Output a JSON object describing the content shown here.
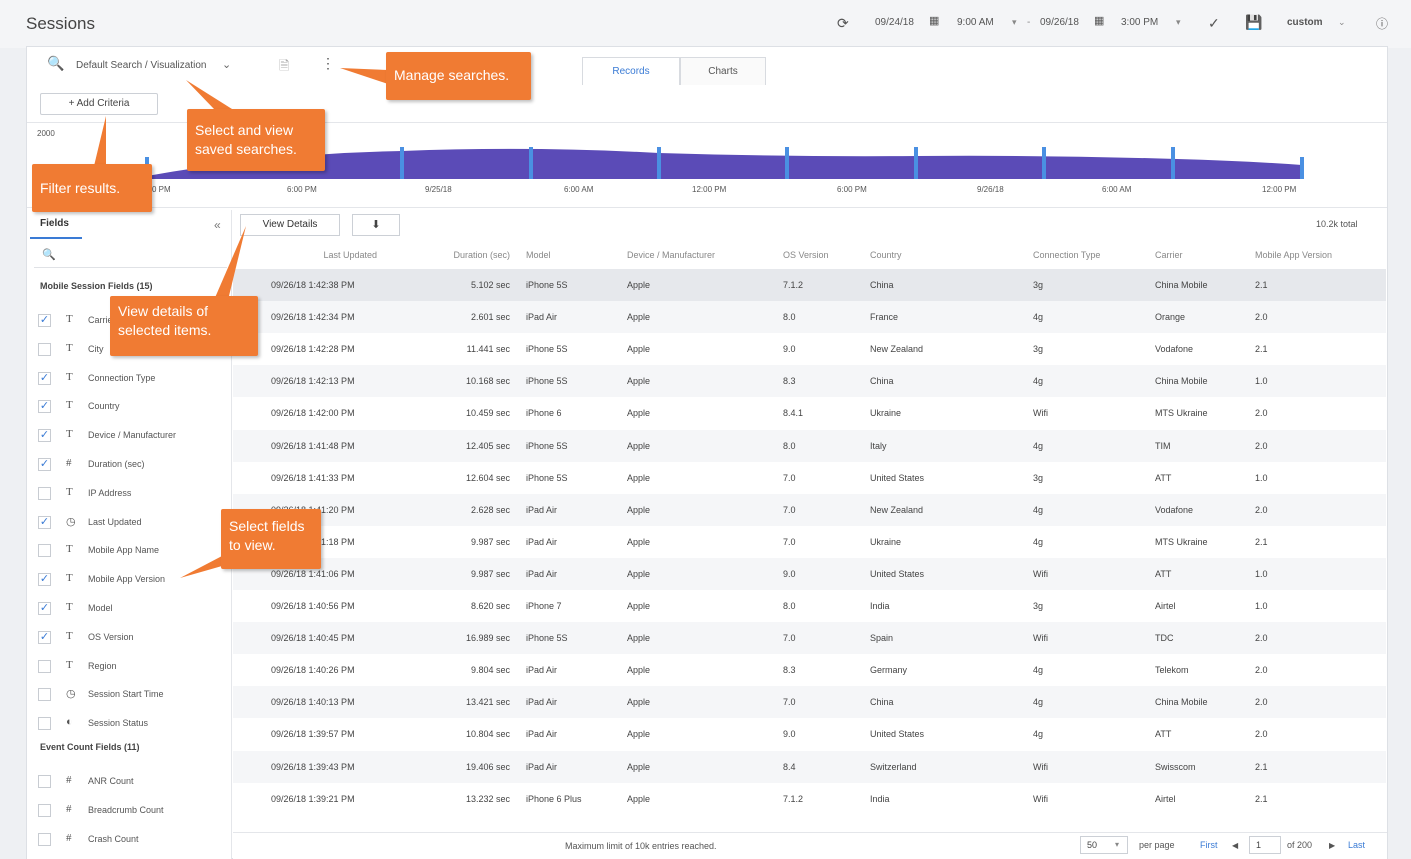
{
  "header": {
    "title": "Sessions",
    "start_date": "09/24/18",
    "start_time": "9:00 AM",
    "end_date": "09/26/18",
    "end_time": "3:00 PM",
    "range_preset": "custom"
  },
  "toolbar": {
    "visualization_label": "Default Search / Visualization",
    "tabs": [
      "Records",
      "Charts"
    ],
    "add_criteria_label": "+ Add Criteria"
  },
  "chart": {
    "y_max_label": "2000",
    "x_ticks": [
      "6:00 PM",
      "9/25/18",
      "6:00 AM",
      "12:00 PM",
      "6:00 PM",
      "9/26/18",
      "6:00 AM",
      "12:00 PM"
    ],
    "partial_first_tick": "0 PM",
    "color": "#5b4bb7",
    "marker_color": "#4a90e2"
  },
  "sidebar": {
    "tab_label": "Fields",
    "collapse_icon": "«",
    "search_placeholder": "",
    "groups": [
      {
        "title": "Mobile Session Fields (15)",
        "fields": [
          {
            "name": "Carrier",
            "type": "T",
            "checked": true
          },
          {
            "name": "City",
            "type": "T",
            "checked": false
          },
          {
            "name": "Connection Type",
            "type": "T",
            "checked": true
          },
          {
            "name": "Country",
            "type": "T",
            "checked": true
          },
          {
            "name": "Device / Manufacturer",
            "type": "T",
            "checked": true
          },
          {
            "name": "Duration (sec)",
            "type": "#",
            "checked": true
          },
          {
            "name": "IP Address",
            "type": "T",
            "checked": false
          },
          {
            "name": "Last Updated",
            "type": "clock",
            "checked": true
          },
          {
            "name": "Mobile App Name",
            "type": "T",
            "checked": false
          },
          {
            "name": "Mobile App Version",
            "type": "T",
            "checked": true
          },
          {
            "name": "Model",
            "type": "T",
            "checked": true
          },
          {
            "name": "OS Version",
            "type": "T",
            "checked": true
          },
          {
            "name": "Region",
            "type": "T",
            "checked": false
          },
          {
            "name": "Session Start Time",
            "type": "clock",
            "checked": false
          },
          {
            "name": "Session Status",
            "type": "half",
            "checked": false
          }
        ]
      },
      {
        "title": "Event Count Fields (11)",
        "fields": [
          {
            "name": "ANR Count",
            "type": "#",
            "checked": false
          },
          {
            "name": "Breadcrumb Count",
            "type": "#",
            "checked": false
          },
          {
            "name": "Crash Count",
            "type": "#",
            "checked": false
          }
        ]
      }
    ]
  },
  "table_toolbar": {
    "view_details_label": "View Details",
    "download_icon": "⬇",
    "total": "10.2k total"
  },
  "table": {
    "columns": [
      "Last Updated",
      "Duration (sec)",
      "Model",
      "Device / Manufacturer",
      "OS Version",
      "Country",
      "Connection Type",
      "Carrier",
      "Mobile App Version"
    ],
    "rows": [
      [
        "09/26/18 1:42:38 PM",
        "5.102 sec",
        "iPhone 5S",
        "Apple",
        "7.1.2",
        "China",
        "3g",
        "China Mobile",
        "2.1"
      ],
      [
        "09/26/18 1:42:34 PM",
        "2.601 sec",
        "iPad Air",
        "Apple",
        "8.0",
        "France",
        "4g",
        "Orange",
        "2.0"
      ],
      [
        "09/26/18 1:42:28 PM",
        "11.441 sec",
        "iPhone 5S",
        "Apple",
        "9.0",
        "New Zealand",
        "3g",
        "Vodafone",
        "2.1"
      ],
      [
        "09/26/18 1:42:13 PM",
        "10.168 sec",
        "iPhone 5S",
        "Apple",
        "8.3",
        "China",
        "4g",
        "China Mobile",
        "1.0"
      ],
      [
        "09/26/18 1:42:00 PM",
        "10.459 sec",
        "iPhone 6",
        "Apple",
        "8.4.1",
        "Ukraine",
        "Wifi",
        "MTS Ukraine",
        "2.0"
      ],
      [
        "09/26/18 1:41:48 PM",
        "12.405 sec",
        "iPhone 5S",
        "Apple",
        "8.0",
        "Italy",
        "4g",
        "TIM",
        "2.0"
      ],
      [
        "09/26/18 1:41:33 PM",
        "12.604 sec",
        "iPhone 5S",
        "Apple",
        "7.0",
        "United States",
        "3g",
        "ATT",
        "1.0"
      ],
      [
        "09/26/18 1:41:20 PM",
        "2.628 sec",
        "iPad Air",
        "Apple",
        "7.0",
        "New Zealand",
        "4g",
        "Vodafone",
        "2.0"
      ],
      [
        "09/26/18 1:41:18 PM",
        "9.987 sec",
        "iPad Air",
        "Apple",
        "7.0",
        "Ukraine",
        "4g",
        "MTS Ukraine",
        "2.1"
      ],
      [
        "09/26/18 1:41:06 PM",
        "9.987 sec",
        "iPad Air",
        "Apple",
        "9.0",
        "United States",
        "Wifi",
        "ATT",
        "1.0"
      ],
      [
        "09/26/18 1:40:56 PM",
        "8.620 sec",
        "iPhone 7",
        "Apple",
        "8.0",
        "India",
        "3g",
        "Airtel",
        "1.0"
      ],
      [
        "09/26/18 1:40:45 PM",
        "16.989 sec",
        "iPhone 5S",
        "Apple",
        "7.0",
        "Spain",
        "Wifi",
        "TDC",
        "2.0"
      ],
      [
        "09/26/18 1:40:26 PM",
        "9.804 sec",
        "iPad Air",
        "Apple",
        "8.3",
        "Germany",
        "4g",
        "Telekom",
        "2.0"
      ],
      [
        "09/26/18 1:40:13 PM",
        "13.421 sec",
        "iPad Air",
        "Apple",
        "7.0",
        "China",
        "4g",
        "China Mobile",
        "2.0"
      ],
      [
        "09/26/18 1:39:57 PM",
        "10.804 sec",
        "iPad Air",
        "Apple",
        "9.0",
        "United States",
        "4g",
        "ATT",
        "2.0"
      ],
      [
        "09/26/18 1:39:43 PM",
        "19.406 sec",
        "iPad Air",
        "Apple",
        "8.4",
        "Switzerland",
        "Wifi",
        "Swisscom",
        "2.1"
      ],
      [
        "09/26/18 1:39:21 PM",
        "13.232 sec",
        "iPhone 6 Plus",
        "Apple",
        "7.1.2",
        "India",
        "Wifi",
        "Airtel",
        "2.1"
      ]
    ]
  },
  "footer": {
    "limit_message": "Maximum limit of 10k entries reached.",
    "per_page_value": "50",
    "per_page_label": "per page",
    "first_label": "First",
    "current_page": "1",
    "of_pages": "of 200",
    "last_label": "Last"
  },
  "callouts": {
    "manage_searches": "Manage searches.",
    "select_view_saved": "Select and view saved searches.",
    "filter_results": "Filter results.",
    "view_details": "View details of selected items.",
    "select_fields": "Select fields to view."
  },
  "colors": {
    "accent": "#3a7bd5",
    "callout": "#f07b33",
    "chart_fill": "#5b4bb7"
  }
}
